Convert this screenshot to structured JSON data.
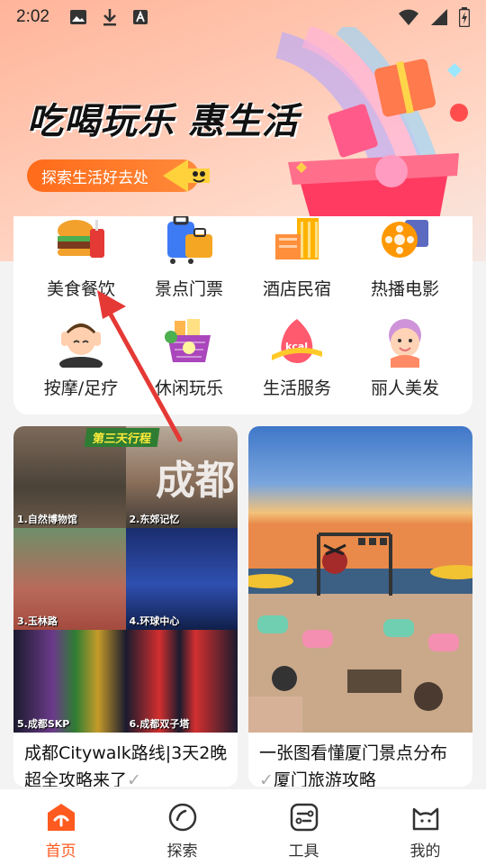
{
  "status_bar": {
    "time": "2:02"
  },
  "banner": {
    "headline": "吃喝玩乐 惠生活",
    "explore_label": "探索生活好去处"
  },
  "categories": [
    {
      "label": "美食餐饮",
      "icon": "burger-drink-icon"
    },
    {
      "label": "景点门票",
      "icon": "suitcase-icon"
    },
    {
      "label": "酒店民宿",
      "icon": "hotel-building-icon"
    },
    {
      "label": "热播电影",
      "icon": "film-reel-icon"
    },
    {
      "label": "按摩/足疗",
      "icon": "massage-person-icon"
    },
    {
      "label": "休闲玩乐",
      "icon": "shopping-basket-icon"
    },
    {
      "label": "生活服务",
      "icon": "kcal-tape-icon"
    },
    {
      "label": "丽人美发",
      "icon": "beauty-face-icon"
    }
  ],
  "feed": [
    {
      "title_line1": "成都Citywalk路线|3天2晚",
      "title_line2": "超全攻略来了",
      "image": {
        "banner": "第三天行程",
        "city": "成都",
        "labels": [
          "1.自然博物馆",
          "2.东郊记忆",
          "3.玉林路",
          "4.环球中心",
          "5.成都SKP",
          "6.成都双子塔"
        ]
      }
    },
    {
      "title_line1": "一张图看懂厦门景点分布",
      "title_line2": "厦门旅游攻略"
    }
  ],
  "bottom_nav": [
    {
      "label": "首页",
      "icon": "home-icon",
      "active": true
    },
    {
      "label": "探索",
      "icon": "compass-icon",
      "active": false
    },
    {
      "label": "工具",
      "icon": "toolbox-icon",
      "active": false
    },
    {
      "label": "我的",
      "icon": "cat-face-icon",
      "active": false
    }
  ],
  "colors": {
    "accent": "#ff5a1f",
    "arrow": "#e53935"
  }
}
